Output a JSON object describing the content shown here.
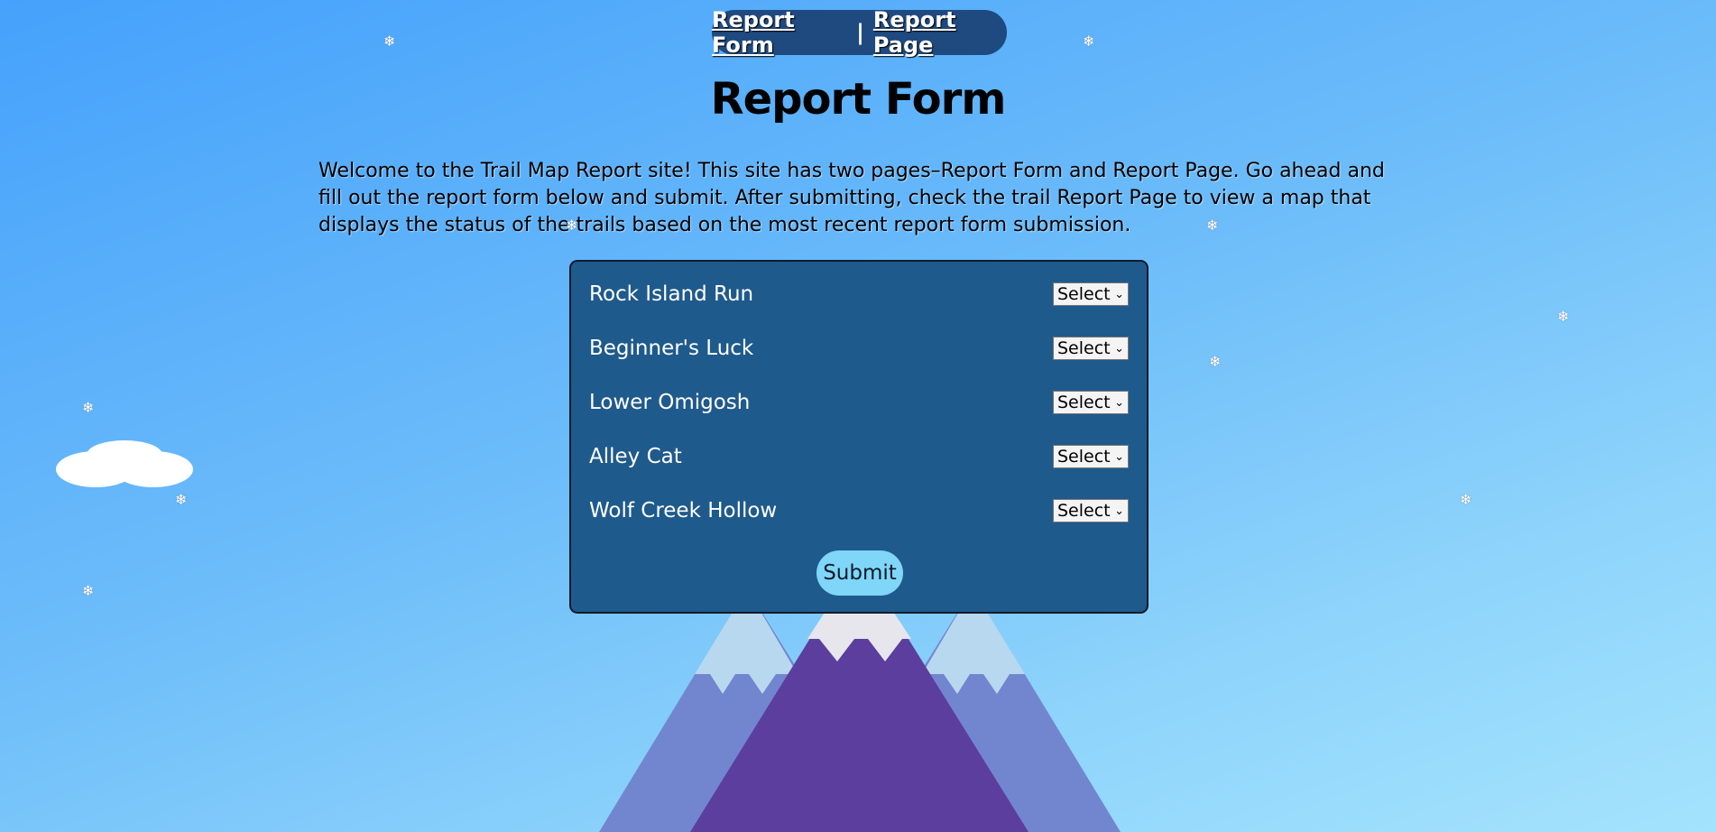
{
  "nav": {
    "link_form": "Report Form",
    "separator": "|",
    "link_page": "Report Page"
  },
  "page_title": "Report Form",
  "intro_text": "Welcome to the Trail Map Report site! This site has two pages–Report Form and Report Page. Go ahead and fill out the report form below and submit. After submitting, check the trail Report Page to view a map that displays the status of the trails based on the most recent report form submission.",
  "form": {
    "trails": [
      {
        "label": "Rock Island Run",
        "select_value": "Select"
      },
      {
        "label": "Beginner's Luck",
        "select_value": "Select"
      },
      {
        "label": "Lower Omigosh",
        "select_value": "Select"
      },
      {
        "label": "Alley Cat",
        "select_value": "Select"
      },
      {
        "label": "Wolf Creek Hollow",
        "select_value": "Select"
      }
    ],
    "submit_label": "Submit"
  },
  "decor": {
    "snowflake_glyph": "❄",
    "colors": {
      "form_bg": "#1f5a8c",
      "nav_bg": "#1e4a80",
      "submit_bg": "#7fd6f8",
      "mountain_front": "#5c3e9e",
      "mountain_back": "#7286cf",
      "snowcap_back": "#b8d8f0",
      "snowcap_front": "#e6e6ec"
    }
  }
}
